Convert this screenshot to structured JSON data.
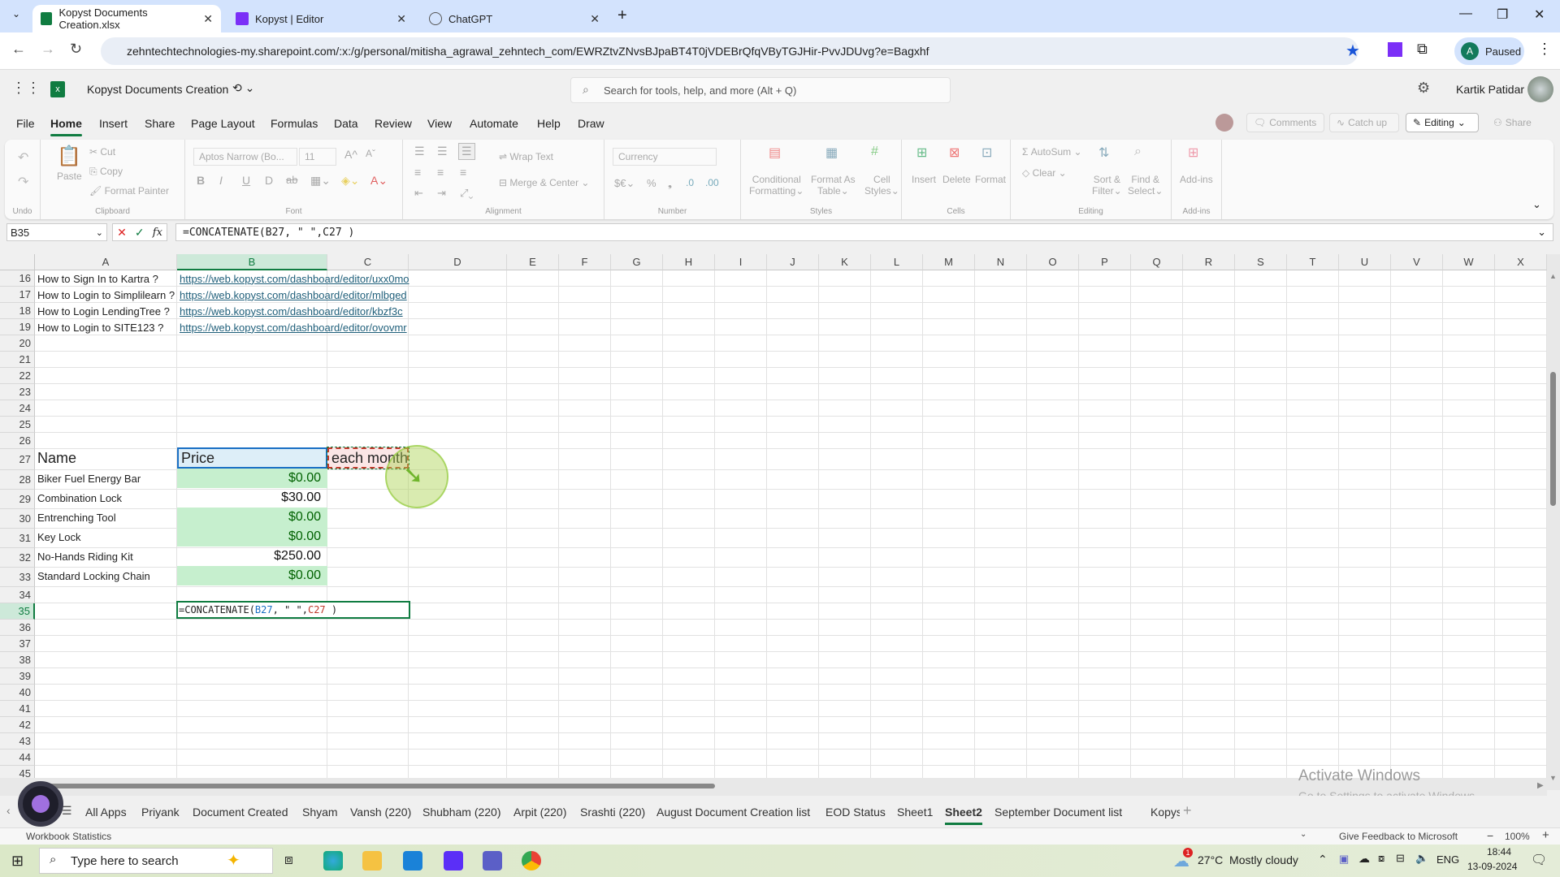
{
  "browser": {
    "tabs": [
      {
        "label": "Kopyst Documents Creation.xlsx",
        "active": true
      },
      {
        "label": "Kopyst | Editor",
        "active": false
      },
      {
        "label": "ChatGPT",
        "active": false
      }
    ],
    "url": "zehntechtechnologies-my.sharepoint.com/:x:/g/personal/mitisha_agrawal_zehntech_com/EWRZtvZNvsBJpaBT4T0jVDEBrQfqVByTGJHir-PvvJDUvg?e=Bagxhf",
    "profile_initial": "A",
    "profile_status": "Paused"
  },
  "app": {
    "doc_title": "Kopyst Documents Creation",
    "search_placeholder": "Search for tools, help, and more (Alt + Q)",
    "user_name": "Kartik Patidar"
  },
  "menu": [
    "File",
    "Home",
    "Insert",
    "Share",
    "Page Layout",
    "Formulas",
    "Data",
    "Review",
    "View",
    "Automate",
    "Help",
    "Draw"
  ],
  "menu_active": "Home",
  "top_buttons": {
    "comments": "Comments",
    "catch_up": "Catch up",
    "editing": "Editing",
    "share": "Share"
  },
  "ribbon": {
    "undo_group": "Undo",
    "clipboard": {
      "paste": "Paste",
      "cut": "Cut",
      "copy": "Copy",
      "format_painter": "Format Painter",
      "label": "Clipboard"
    },
    "font": {
      "name": "Aptos Narrow (Bo...",
      "size": "11",
      "label": "Font"
    },
    "alignment": {
      "wrap": "Wrap Text",
      "merge": "Merge & Center",
      "label": "Alignment"
    },
    "number": {
      "format": "Currency",
      "label": "Number"
    },
    "styles": {
      "conditional": "Conditional",
      "conditional2": "Formatting",
      "format_as": "Format As",
      "table": "Table",
      "cell": "Cell",
      "styles": "Styles",
      "label": "Styles"
    },
    "cells": {
      "insert": "Insert",
      "delete": "Delete",
      "format": "Format",
      "label": "Cells"
    },
    "editing": {
      "autosum": "AutoSum",
      "clear": "Clear",
      "sort": "Sort &",
      "filter": "Filter",
      "find": "Find &",
      "select": "Select",
      "label": "Editing"
    },
    "addins": {
      "addins": "Add-ins",
      "label": "Add-ins"
    }
  },
  "formula_bar": {
    "name_box": "B35",
    "formula": "=CONCATENATE(B27, \" \",C27 )"
  },
  "columns": [
    "A",
    "B",
    "C",
    "D",
    "E",
    "F",
    "G",
    "H",
    "I",
    "J",
    "K",
    "L",
    "M",
    "N",
    "O",
    "P",
    "Q",
    "R",
    "S",
    "T",
    "U",
    "V",
    "W",
    "X"
  ],
  "rows": [
    "16",
    "17",
    "18",
    "19",
    "20",
    "21",
    "22",
    "23",
    "24",
    "25",
    "26",
    "27",
    "28",
    "29",
    "30",
    "31",
    "32",
    "33",
    "34",
    "35",
    "36",
    "37",
    "38",
    "39",
    "40",
    "41",
    "42",
    "43",
    "44",
    "45"
  ],
  "cells": {
    "A16": "How to Sign In to Kartra ?",
    "A17": "How to Login to Simplilearn ?",
    "A18": "How to Login LendingTree ?",
    "A19": "How to Login to SITE123 ?",
    "B16": "https://web.kopyst.com/dashboard/editor/uxx0mo",
    "B17": "https://web.kopyst.com/dashboard/editor/mlbged",
    "B18": "https://web.kopyst.com/dashboard/editor/kbzf3c",
    "B19": "https://web.kopyst.com/dashboard/editor/ovovmr",
    "A27": "Name",
    "B27": "Price",
    "C27": "each month",
    "A28": "Biker Fuel Energy Bar",
    "A29": "Combination Lock",
    "A30": "Entrenching Tool",
    "A31": "Key Lock",
    "A32": "No-Hands Riding Kit",
    "A33": "Standard Locking Chain",
    "B28": "$0.00",
    "B29": "$30.00",
    "B30": "$0.00",
    "B31": "$0.00",
    "B32": "$250.00",
    "B33": "$0.00",
    "B35": "=CONCATENATE(B27, \" \",C27 )"
  },
  "formula_parts": {
    "pre": "=CONCATENATE(",
    "ref1": "B27",
    "mid": ", \" \",",
    "ref2": "C27",
    "post": " )"
  },
  "sheets": [
    "All Apps",
    "Priyank",
    "Document Created",
    "Shyam",
    "Vansh (220)",
    "Shubham (220)",
    "Arpit (220)",
    "Srashti (220)",
    "August Document Creation list",
    "EOD Status",
    "Sheet1",
    "Sheet2",
    "September Document list",
    "Kopyst U"
  ],
  "active_sheet": "Sheet2",
  "status": {
    "left": "Workbook Statistics",
    "feedback": "Give Feedback to Microsoft",
    "zoom": "100%"
  },
  "watermark": {
    "line1": "Activate Windows",
    "line2": "Go to Settings to activate Windows."
  },
  "taskbar": {
    "search_placeholder": "Type here to search",
    "weather": "27°C  Mostly cloudy",
    "lang": "ENG",
    "time": "18:44",
    "date": "13-09-2024",
    "weather_badge": "1"
  }
}
